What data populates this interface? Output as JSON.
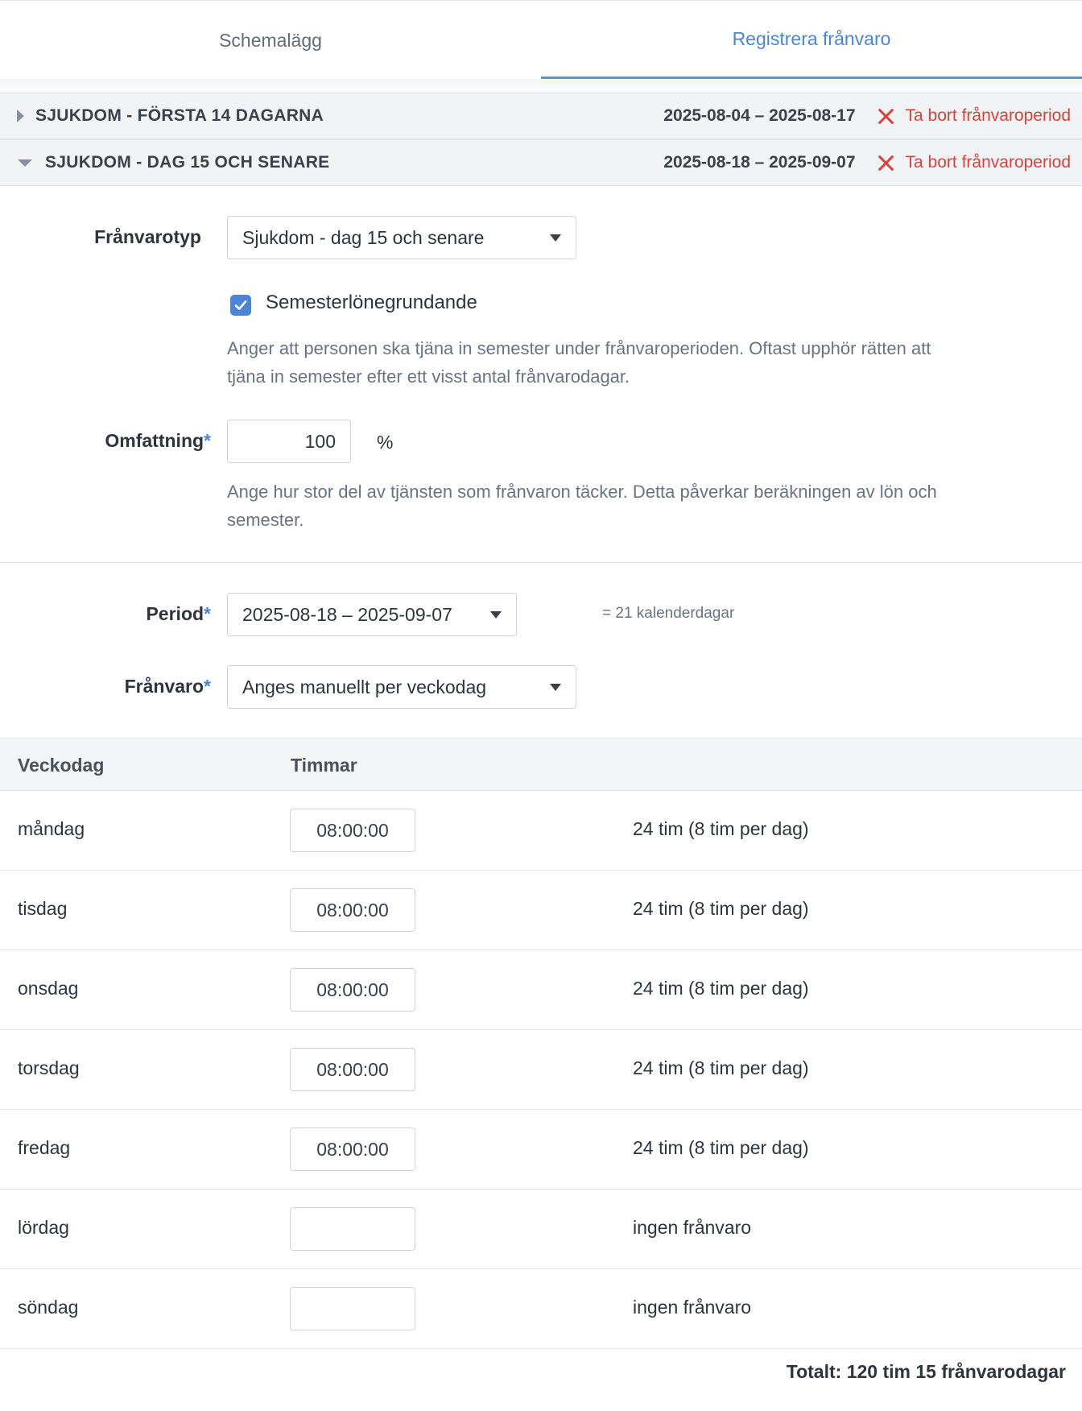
{
  "tabs": [
    {
      "label": "Schemalägg",
      "active": false
    },
    {
      "label": "Registrera frånvaro",
      "active": true
    }
  ],
  "periods": [
    {
      "title": "SJUKDOM - FÖRSTA 14 DAGARNA",
      "dates": "2025-08-04 – 2025-08-17",
      "remove_label": "Ta bort frånvaroperiod",
      "expanded": false
    },
    {
      "title": "SJUKDOM - DAG 15 OCH SENARE",
      "dates": "2025-08-18 – 2025-09-07",
      "remove_label": "Ta bort frånvaroperiod",
      "expanded": true
    }
  ],
  "form": {
    "type_label": "Frånvarotyp",
    "type_value": "Sjukdom - dag 15 och senare",
    "checkbox_label": "Semesterlönegrundande",
    "checkbox_checked": true,
    "checkbox_help": "Anger att personen ska tjäna in semester under frånvaroperioden. Oftast upphör rätten att tjäna in semester efter ett visst antal frånvarodagar.",
    "scope_label": "Omfattning",
    "scope_value": "100",
    "scope_unit": "%",
    "scope_help": "Ange hur stor del av tjänsten som frånvaron täcker. Detta påverkar beräkningen av lön och semester.",
    "required_marker": "*",
    "period_label": "Period",
    "period_value": "2025-08-18 – 2025-09-07",
    "period_days": "= 21 kalenderdagar",
    "absence_label": "Frånvaro",
    "absence_value": "Anges manuellt per veckodag"
  },
  "table": {
    "headers": [
      "Veckodag",
      "Timmar"
    ],
    "rows": [
      {
        "day": "måndag",
        "hours": "08:00:00",
        "summary": "24 tim (8 tim per dag)"
      },
      {
        "day": "tisdag",
        "hours": "08:00:00",
        "summary": "24 tim (8 tim per dag)"
      },
      {
        "day": "onsdag",
        "hours": "08:00:00",
        "summary": "24 tim (8 tim per dag)"
      },
      {
        "day": "torsdag",
        "hours": "08:00:00",
        "summary": "24 tim (8 tim per dag)"
      },
      {
        "day": "fredag",
        "hours": "08:00:00",
        "summary": "24 tim (8 tim per dag)"
      },
      {
        "day": "lördag",
        "hours": "",
        "summary": "ingen frånvaro"
      },
      {
        "day": "söndag",
        "hours": "",
        "summary": "ingen frånvaro"
      }
    ],
    "total": "Totalt: 120 tim 15 frånvarodagar"
  },
  "colors": {
    "accent": "#4a86d8",
    "danger": "#d9423b"
  }
}
